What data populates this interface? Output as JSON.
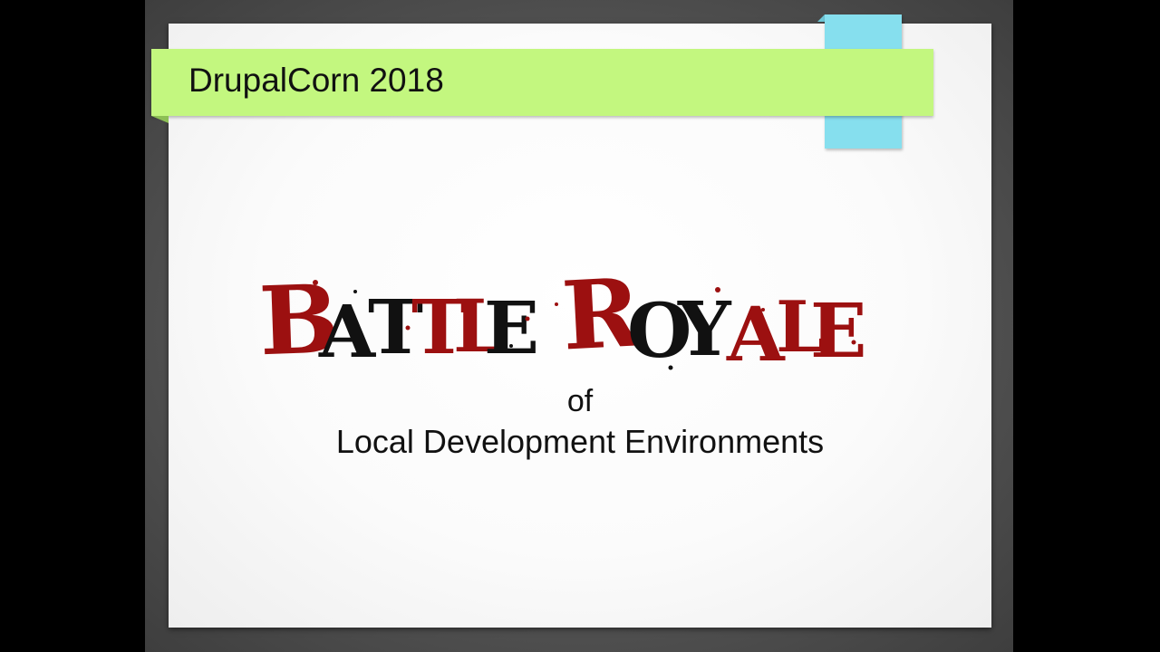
{
  "slide": {
    "banner_title": "DrupalCorn 2018",
    "logo_text": {
      "word1": "BATTLE",
      "word2": "ROYALE"
    },
    "subtitle_of": "of",
    "subtitle_main": "Local Development Environments"
  },
  "colors": {
    "banner_green": "#c3f77f",
    "tab_blue": "#86dfee",
    "logo_red": "#9c1010",
    "logo_black": "#111111"
  }
}
